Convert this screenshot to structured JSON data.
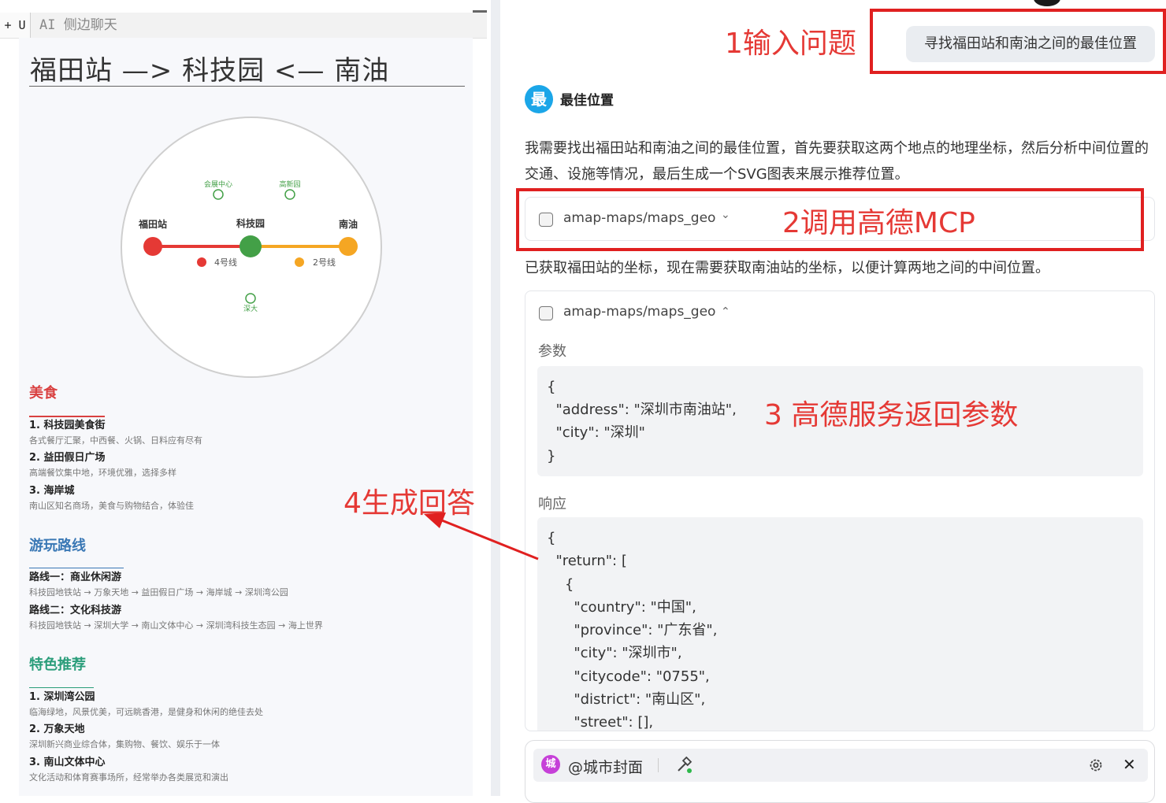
{
  "left": {
    "toolbar": {
      "plus_u": "+ U",
      "tab_title": "AI 侧边聊天"
    },
    "route_title": "福田站 —> 科技园 <— 南油",
    "map": {
      "stations": {
        "futian": "福田站",
        "kejiyuan": "科技园",
        "nanyou": "南油"
      },
      "pois": {
        "huizhan": "会展中心",
        "gaoxinyuan": "高新园",
        "shenda": "深大"
      },
      "legend": {
        "line4": "4号线",
        "line2": "2号线"
      },
      "colors": {
        "line4": "#e53935",
        "line2": "#f5a623",
        "center": "#43a047",
        "poi": "#43a047"
      }
    },
    "food": {
      "heading": "美食",
      "items": [
        {
          "title": "1. 科技园美食街",
          "desc": "各式餐厅汇聚，中西餐、火锅、日料应有尽有"
        },
        {
          "title": "2. 益田假日广场",
          "desc": "高端餐饮集中地，环境优雅，选择多样"
        },
        {
          "title": "3. 海岸城",
          "desc": "南山区知名商场，美食与购物结合，体验佳"
        }
      ]
    },
    "routes": {
      "heading": "游玩路线",
      "items": [
        {
          "title": "路线一：商业休闲游",
          "desc": "科技园地铁站 → 万象天地 → 益田假日广场 → 海岸城 → 深圳湾公园"
        },
        {
          "title": "路线二：文化科技游",
          "desc": "科技园地铁站 → 深圳大学 → 南山文体中心 → 深圳湾科技生态园 → 海上世界"
        }
      ]
    },
    "featured": {
      "heading": "特色推荐",
      "items": [
        {
          "title": "1. 深圳湾公园",
          "desc": "临海绿地，风景优美，可远眺香港，是健身和休闲的绝佳去处"
        },
        {
          "title": "2. 万象天地",
          "desc": "深圳新兴商业综合体，集购物、餐饮、娱乐于一体"
        },
        {
          "title": "3. 南山文体中心",
          "desc": "文化活动和体育赛事场所，经常举办各类展览和演出"
        }
      ]
    },
    "heading_colors": {
      "food": "#d94040",
      "routes": "#3a78b5",
      "featured": "#2a9d7a"
    }
  },
  "annotations": {
    "a1": "1输入问题",
    "a2": "2调用高德MCP",
    "a3": "3 高德服务返回参数",
    "a4": "4生成回答"
  },
  "chat": {
    "user_question": "寻找福田站和南油之间的最佳位置",
    "assistant": {
      "avatar_char": "最",
      "section_title": "最佳位置",
      "paragraph1": "我需要找出福田站和南油之间的最佳位置，首先要获取这两个地点的地理坐标，然后分析中间位置的交通、设施等情况，最后生成一个SVG图表来展示推荐位置。",
      "tool_call_1": {
        "name": "amap-maps/maps_geo",
        "chevron": "⌄"
      },
      "paragraph2": "已获取福田站的坐标，现在需要获取南油站的坐标，以便计算两地之间的中间位置。",
      "tool_call_2": {
        "name": "amap-maps/maps_geo",
        "chevron": "⌃",
        "params_label": "参数",
        "params_lines": [
          "{",
          "  \"address\": \"深圳市南油站\",",
          "  \"city\": \"深圳\"",
          "}"
        ],
        "response_label": "响应",
        "response_lines": [
          "{",
          "  \"return\": [",
          "    {",
          "      \"country\": \"中国\",",
          "      \"province\": \"广东省\",",
          "      \"city\": \"深圳市\",",
          "      \"citycode\": \"0755\",",
          "      \"district\": \"南山区\",",
          "      \"street\": [],"
        ]
      }
    }
  },
  "input_bar": {
    "mention_icon_char": "城",
    "mention": "@城市封面",
    "tools_icon": "hammer-icon",
    "settings_icon": "gear-icon",
    "close": "✕"
  }
}
